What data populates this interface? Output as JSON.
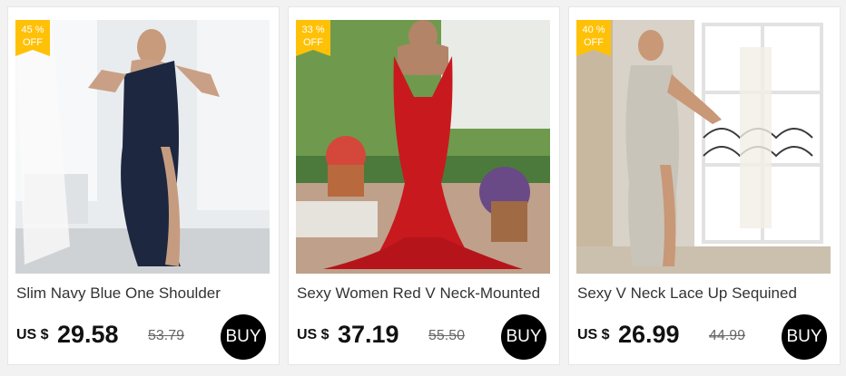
{
  "colors": {
    "badge": "#ffc107",
    "buy_button": "#000000",
    "card_background": "#ffffff",
    "page_background": "#f2f2f2"
  },
  "products": [
    {
      "discount_percent": "45 %",
      "discount_off": "OFF",
      "title": "Slim Navy Blue One Shoulder",
      "currency": "US $",
      "price": "29.58",
      "old_price": "53.79",
      "buy_label": "BUY"
    },
    {
      "discount_percent": "33 %",
      "discount_off": "OFF",
      "title": "Sexy Women Red V Neck-Mounted",
      "currency": "US $",
      "price": "37.19",
      "old_price": "55.50",
      "buy_label": "BUY"
    },
    {
      "discount_percent": "40 %",
      "discount_off": "OFF",
      "title": "Sexy V Neck Lace Up Sequined",
      "currency": "US $",
      "price": "26.99",
      "old_price": "44.99",
      "buy_label": "BUY"
    }
  ]
}
